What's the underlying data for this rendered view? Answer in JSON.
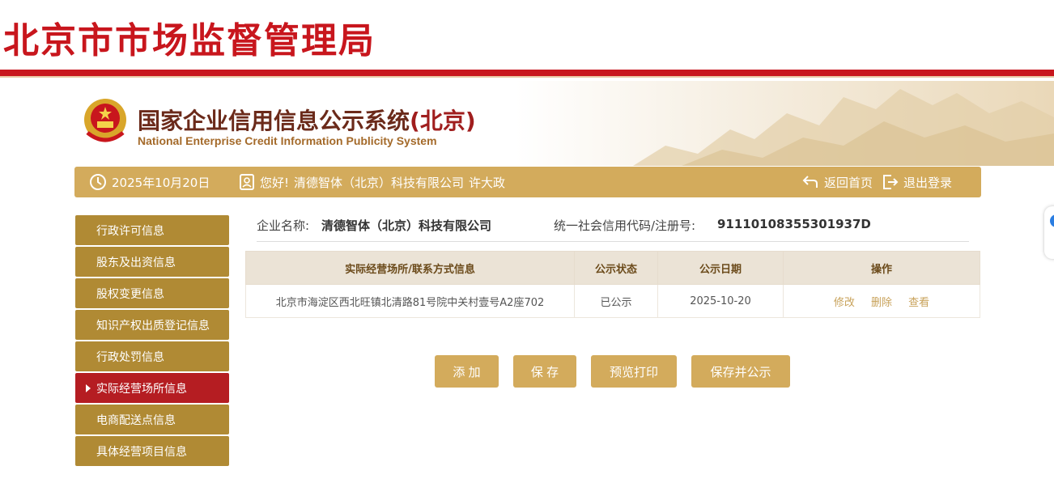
{
  "header": {
    "title": "北京市市场监督管理局",
    "system_title": "国家企业信用信息公示系统",
    "system_region": "(北京)",
    "system_subtitle": "National Enterprise Credit Information Publicity System"
  },
  "infobar": {
    "date": "2025年10月20日",
    "greeting": "您好!",
    "company": "清德智体（北京）科技有限公司",
    "user": "许大政",
    "home_label": "返回首页",
    "logout_label": "退出登录"
  },
  "sidebar": {
    "items": [
      {
        "label": "行政许可信息",
        "active": false
      },
      {
        "label": "股东及出资信息",
        "active": false
      },
      {
        "label": "股权变更信息",
        "active": false
      },
      {
        "label": "知识产权出质登记信息",
        "active": false
      },
      {
        "label": "行政处罚信息",
        "active": false
      },
      {
        "label": "实际经营场所信息",
        "active": true
      },
      {
        "label": "电商配送点信息",
        "active": false
      },
      {
        "label": "具体经营项目信息",
        "active": false
      }
    ]
  },
  "company_info": {
    "name_label": "企业名称:",
    "name_value": "清德智体（北京）科技有限公司",
    "code_label": "统一社会信用代码/注册号:",
    "code_value": "91110108355301937D"
  },
  "table": {
    "headers": [
      "实际经营场所/联系方式信息",
      "公示状态",
      "公示日期",
      "操作"
    ],
    "rows": [
      {
        "address": "北京市海淀区西北旺镇北清路81号院中关村壹号A2座702",
        "status": "已公示",
        "date": "2025-10-20",
        "ops": [
          "修改",
          "删除",
          "查看"
        ]
      }
    ]
  },
  "buttons": {
    "add": "添 加",
    "save": "保 存",
    "preview_print": "预览打印",
    "save_publish": "保存并公示"
  },
  "colors": {
    "brand_red": "#c8161d",
    "gold": "#d3ab5c",
    "sidebar_gold": "#b08a34",
    "active_red": "#b51d22"
  }
}
